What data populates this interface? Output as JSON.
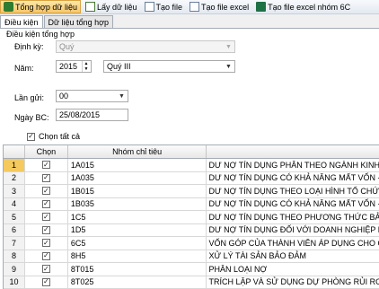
{
  "toolbar": {
    "buttons": [
      {
        "label": "Tổng hợp dữ liệu",
        "icon": "summary-icon"
      },
      {
        "label": "Lấy dữ liệu",
        "icon": "fetch-data-icon"
      },
      {
        "label": "Tạo file",
        "icon": "file-icon"
      },
      {
        "label": "Tạo file excel",
        "icon": "excel-icon"
      },
      {
        "label": "Tạo file excel nhóm 6C",
        "icon": "excel-icon"
      }
    ]
  },
  "tabs": [
    "Điều kiện",
    "Dữ liệu tổng hợp"
  ],
  "conditions": {
    "group_label": "Điều kiện tổng hợp",
    "period_label": "Định kỳ:",
    "period_value": "Quý",
    "year_label": "Năm:",
    "year_value": "2015",
    "quarter_value": "Quý III",
    "send_label": "Lần gửi:",
    "send_value": "00",
    "date_label": "Ngày BC:",
    "date_value": "25/08/2015",
    "select_all_label": "Chọn tất cả"
  },
  "grid": {
    "headers": [
      "",
      "Chọn",
      "Nhóm chỉ tiêu",
      ""
    ],
    "rows": [
      {
        "num": "1",
        "code": "1A015",
        "name": "DƯ NỢ TÍN DỤNG PHÂN THEO NGÀNH KINH T"
      },
      {
        "num": "2",
        "code": "1A035",
        "name": "DƯ NỢ TÍN DỤNG CÓ KHẢ NĂNG MẤT VỐN - N"
      },
      {
        "num": "3",
        "code": "1B015",
        "name": "DƯ NỢ TÍN DỤNG THEO LOẠI HÌNH TỔ CHỨC"
      },
      {
        "num": "4",
        "code": "1B035",
        "name": "DƯ NỢ TÍN DỤNG CÓ KHẢ NĂNG MẤT VỐN - N"
      },
      {
        "num": "5",
        "code": "1C5",
        "name": "DƯ NỢ TÍN DỤNG THEO PHƯƠNG THỨC BẢO"
      },
      {
        "num": "6",
        "code": "1D5",
        "name": "DƯ NỢ TÍN DỤNG ĐỐI VỚI DOANH NGHIỆP NH"
      },
      {
        "num": "7",
        "code": "6C5",
        "name": "VỐN GÓP CỦA THÀNH VIÊN ÁP DỤNG CHO QU"
      },
      {
        "num": "8",
        "code": "8H5",
        "name": "XỬ LÝ TÀI SẢN BẢO ĐẢM"
      },
      {
        "num": "9",
        "code": "8T015",
        "name": "PHÂN LOẠI NỢ"
      },
      {
        "num": "10",
        "code": "8T025",
        "name": "TRÍCH LẬP VÀ SỬ DỤNG DỰ PHÒNG RỦI RO"
      }
    ]
  }
}
